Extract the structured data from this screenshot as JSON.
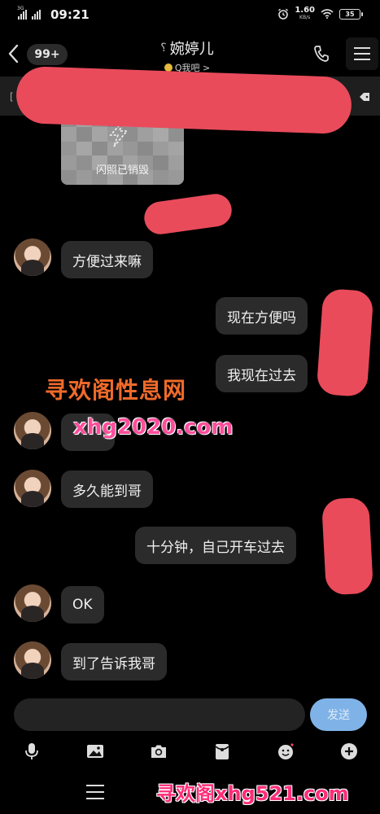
{
  "status": {
    "signal_label": "3G",
    "time": "09:21",
    "speed_value": "1.60",
    "speed_unit": "KB/s",
    "battery": "35"
  },
  "header": {
    "unread_badge": "99+",
    "title": "婉婷儿",
    "subtitle": "Q我吧 >"
  },
  "notice": {
    "prefix": "["
  },
  "flash_photo": {
    "label": "闪照已销毁"
  },
  "messages": [
    {
      "side": "left",
      "text": "方便过来嘛"
    },
    {
      "side": "right",
      "text": "现在方便吗"
    },
    {
      "side": "right",
      "text": "我现在过去"
    },
    {
      "side": "left",
      "text": ""
    },
    {
      "side": "left",
      "text": "多久能到哥"
    },
    {
      "side": "right",
      "text": "十分钟，自己开车过去"
    },
    {
      "side": "left",
      "text": "OK"
    },
    {
      "side": "left",
      "text": "到了告诉我哥"
    }
  ],
  "watermarks": {
    "line1": "寻欢阁性息网",
    "line2": "xhg2020.com",
    "line3": "寻欢阁xhg521.com"
  },
  "composer": {
    "input_value": "",
    "send_label": "发送"
  },
  "toolbar": {
    "icons": [
      "microphone-icon",
      "image-icon",
      "camera-icon",
      "red-packet-icon",
      "emoji-icon",
      "plus-icon"
    ]
  },
  "colors": {
    "background": "#000000",
    "bubble": "#2b2b2b",
    "send_button": "#7fb3e8",
    "redaction": "#e94b5b"
  }
}
